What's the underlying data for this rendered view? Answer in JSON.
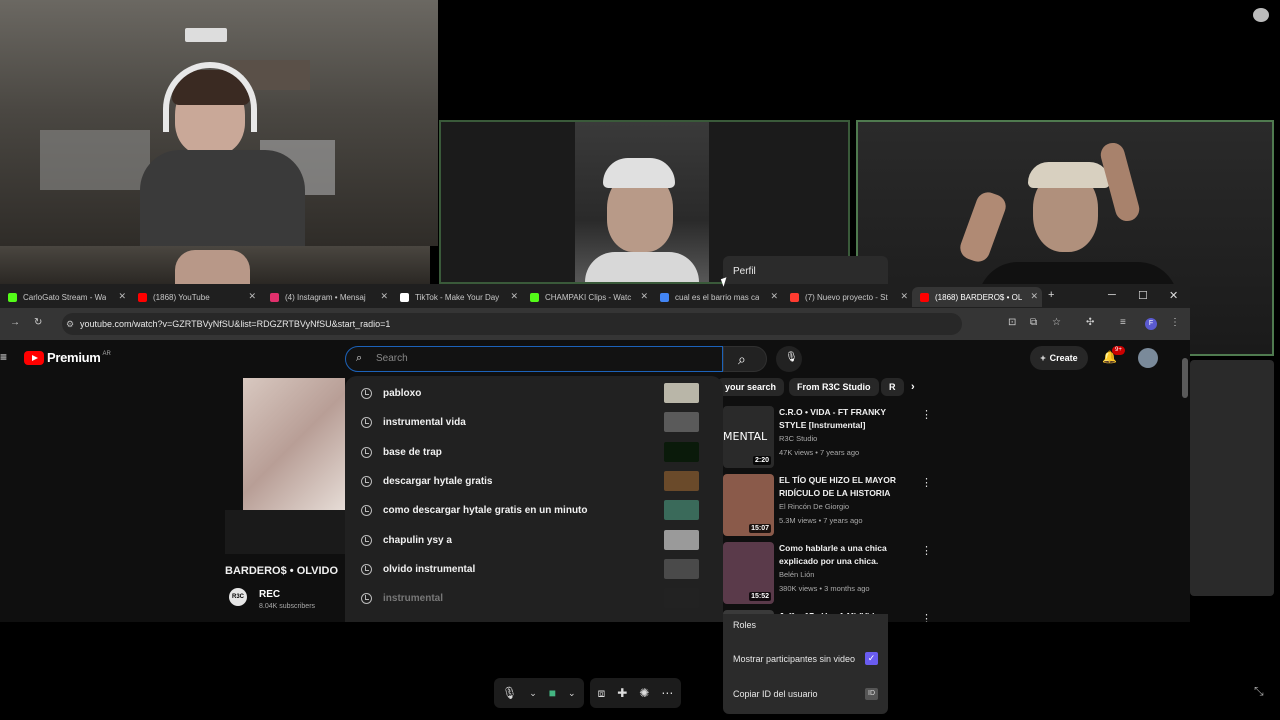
{
  "meeting": {
    "perfil_label": "Perfil",
    "menu_items": {
      "roles": "Roles",
      "show_participants": "Mostrar participantes sin video",
      "copy_id": "Copiar ID del usuario",
      "id_badge": "ID"
    },
    "controls": [
      "mic-icon",
      "chevron-down-icon",
      "camera-icon",
      "chevron-down-icon",
      "share-screen-icon",
      "apps-icon",
      "reactions-icon",
      "more-icon"
    ],
    "accent_color": "#6a5cf0"
  },
  "browser": {
    "tabs": [
      {
        "label": "CarloGato Stream - Wa",
        "color": "#53fc18",
        "active": false
      },
      {
        "label": "(1868) YouTube",
        "color": "#ff0000",
        "active": false
      },
      {
        "label": "(4) Instagram • Mensaj",
        "color": "#e1306c",
        "active": false
      },
      {
        "label": "TikTok - Make Your Day",
        "color": "#ffffff",
        "active": false
      },
      {
        "label": "CHAMPAKI Clips - Watc",
        "color": "#53fc18",
        "active": false
      },
      {
        "label": "cual es el barrio mas ca",
        "color": "#4285f4",
        "active": false
      },
      {
        "label": "(7) Nuevo proyecto - St",
        "color": "#ff3b30",
        "active": false
      },
      {
        "label": "(1868) BARDERO$ • OL",
        "color": "#ff0000",
        "active": true
      }
    ],
    "new_tab": "+",
    "url": "youtube.com/watch?v=GZRTBVyNfSU&list=RDGZRTBVyNfSU&start_radio=1"
  },
  "youtube": {
    "brand": "Premium",
    "region": "AR",
    "search_placeholder": "Search",
    "create_label": "Create",
    "notif_count": "9+",
    "suggestions": [
      {
        "text": "pabloxo",
        "thumb": "#b9b6a8"
      },
      {
        "text": "instrumental vida",
        "thumb": "#5a5a5a"
      },
      {
        "text": "base de trap",
        "thumb": "#0a1a0a"
      },
      {
        "text": "descargar hytale gratis",
        "thumb": "#6a4a2a"
      },
      {
        "text": "como descargar hytale gratis en un minuto",
        "thumb": "#3a6a5a"
      },
      {
        "text": "chapulin ysy a",
        "thumb": "#9a9a9a"
      },
      {
        "text": "olvido instrumental",
        "thumb": "#4a4a4a"
      },
      {
        "text": "instrumental",
        "thumb": "#222222"
      }
    ],
    "video": {
      "title": "BARDERO$ • OLVIDO",
      "channel": "REC",
      "channel_avatar": "R3C",
      "subscribers": "8.04K subscribers"
    },
    "chips": [
      "your search",
      "From R3C Studio",
      "R"
    ],
    "recommendations": [
      {
        "title": "C.R.O • VIDA - FT FRANKY STYLE [Instrumental]",
        "channel": "R3C Studio",
        "meta": "47K views • 7 years ago",
        "duration": "2:20",
        "thumb_label": "MENTAL",
        "thumb": "#2a2a2a"
      },
      {
        "title": "EL TÍO QUE HIZO EL MAYOR RIDÍCULO DE LA HISTORIA",
        "channel": "El Rincón De Giorgio",
        "meta": "5.3M views • 7 years ago",
        "duration": "15:07",
        "thumb_label": "",
        "thumb": "#8a5a4a"
      },
      {
        "title": "Como hablarle a una chica explicado por una chica.",
        "channel": "Belén Lión",
        "meta": "380K views • 3 months ago",
        "duration": "15:52",
        "thumb_label": "",
        "thumb": "#5a3a4a"
      },
      {
        "title": "Jeffer 17 - Voy A Mi (Video",
        "channel": "",
        "meta": "",
        "duration": "",
        "thumb_label": "",
        "thumb": "#3a3a3a"
      }
    ]
  }
}
